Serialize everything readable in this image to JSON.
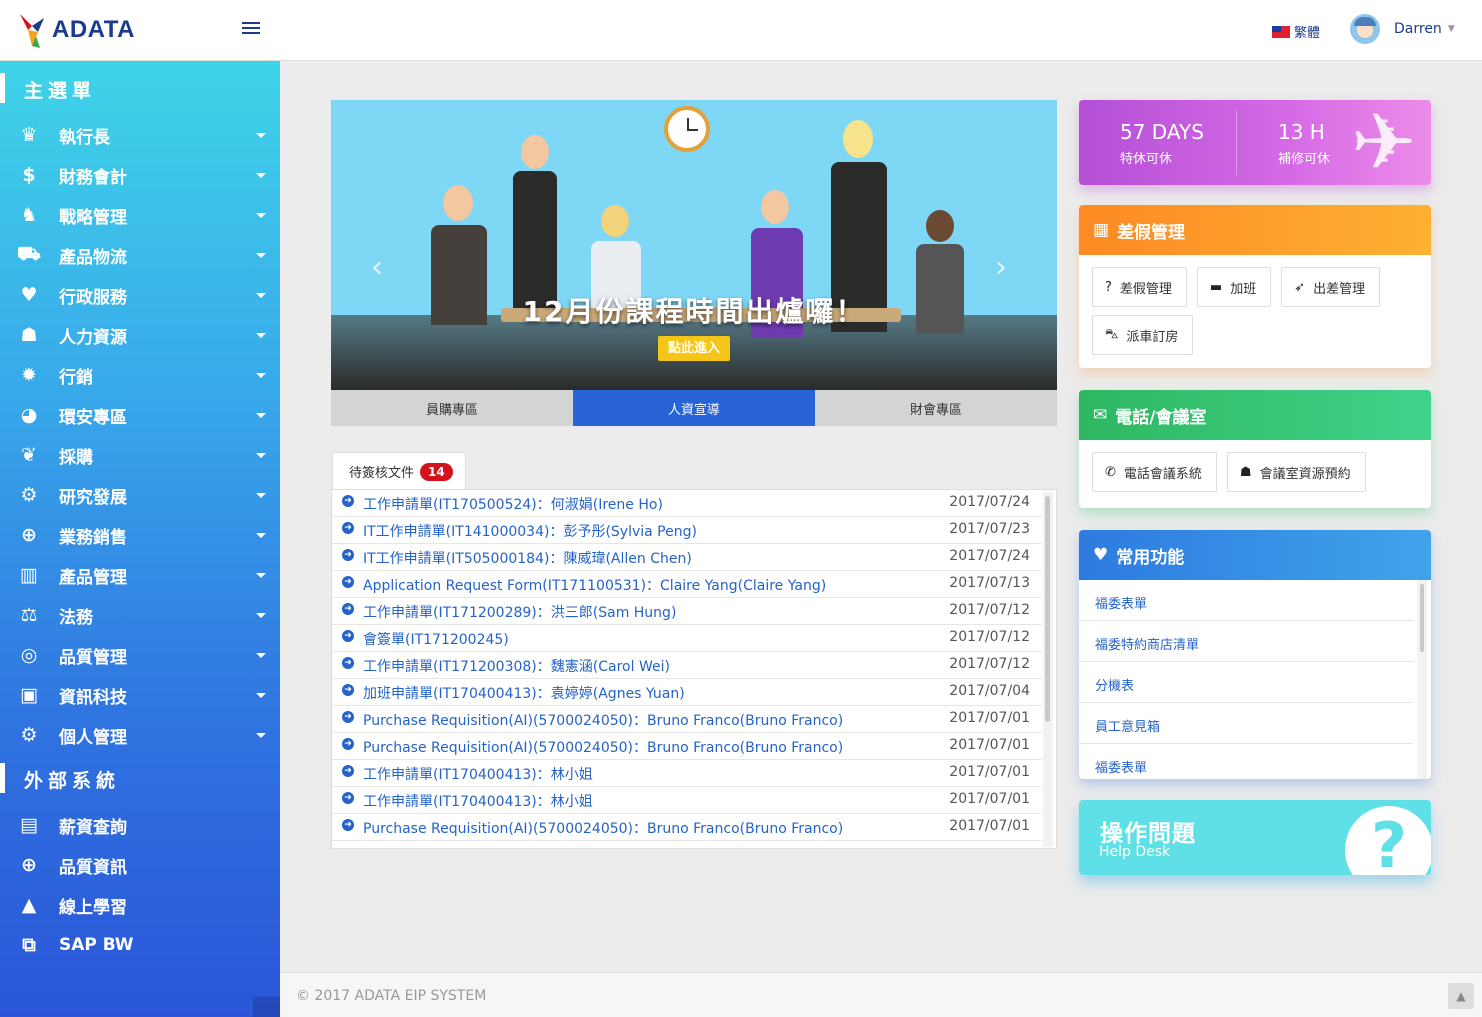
{
  "header": {
    "logo_text": "ADATA",
    "language": "繁體",
    "user_name": "Darren"
  },
  "sidebar": {
    "main_title": "主選單",
    "main_items": [
      {
        "label": "執行長",
        "icon": "crown-icon",
        "glyph": "♛"
      },
      {
        "label": "財務會計",
        "icon": "money-icon",
        "glyph": "$"
      },
      {
        "label": "戰略管理",
        "icon": "chess-knight-icon",
        "glyph": "♞"
      },
      {
        "label": "產品物流",
        "icon": "truck-icon",
        "glyph": "⛟"
      },
      {
        "label": "行政服務",
        "icon": "heart-icon",
        "glyph": "♥"
      },
      {
        "label": "人力資源",
        "icon": "users-icon",
        "glyph": "☗"
      },
      {
        "label": "行銷",
        "icon": "lightbulb-icon",
        "glyph": "✹"
      },
      {
        "label": "環安專區",
        "icon": "globe-icon",
        "glyph": "◕"
      },
      {
        "label": "採購",
        "icon": "plant-icon",
        "glyph": "❦"
      },
      {
        "label": "研究發展",
        "icon": "brain-icon",
        "glyph": "⚙"
      },
      {
        "label": "業務銷售",
        "icon": "network-globe-icon",
        "glyph": "⊕"
      },
      {
        "label": "產品管理",
        "icon": "bar-chart-icon",
        "glyph": "▥"
      },
      {
        "label": "法務",
        "icon": "scale-icon",
        "glyph": "⚖"
      },
      {
        "label": "品質管理",
        "icon": "circle-notch-icon",
        "glyph": "◎"
      },
      {
        "label": "資訊科技",
        "icon": "monitor-icon",
        "glyph": "▣"
      },
      {
        "label": "個人管理",
        "icon": "gear-icon",
        "glyph": "⚙"
      }
    ],
    "external_title": "外部系統",
    "external_items": [
      {
        "label": "薪資查詢",
        "icon": "money-bill-icon",
        "glyph": "▤"
      },
      {
        "label": "品質資訊",
        "icon": "search-plus-icon",
        "glyph": "⊕"
      },
      {
        "label": "線上學習",
        "icon": "graduation-cap-icon",
        "glyph": "▲"
      },
      {
        "label": "SAP BW",
        "icon": "windows-icon",
        "glyph": "⧉"
      }
    ]
  },
  "carousel": {
    "title": "12月份課程時間出爐囉！",
    "button": "點此進入",
    "tabs": [
      {
        "label": "員購專區",
        "active": false
      },
      {
        "label": "人資宣導",
        "active": true
      },
      {
        "label": "財會專區",
        "active": false
      }
    ]
  },
  "pending": {
    "tab_label": "待簽核文件",
    "count": "14",
    "rows": [
      {
        "title": "工作申請單(IT170500524)：何淑娟(Irene Ho)",
        "date": "2017/07/24"
      },
      {
        "title": "IT工作申請單(IT141000034)：彭予彤(Sylvia Peng)",
        "date": "2017/07/23"
      },
      {
        "title": "IT工作申請單(IT505000184)：陳威瑋(Allen Chen)",
        "date": "2017/07/24"
      },
      {
        "title": "Application Request Form(IT171100531)：Claire Yang(Claire Yang)",
        "date": "2017/07/13"
      },
      {
        "title": "工作申請單(IT171200289)：洪三郎(Sam Hung)",
        "date": "2017/07/12"
      },
      {
        "title": "會簽單(IT171200245)",
        "date": "2017/07/12"
      },
      {
        "title": "工作申請單(IT171200308)：魏憲涵(Carol Wei)",
        "date": "2017/07/12"
      },
      {
        "title": "加班申請單(IT170400413)：袁婷婷(Agnes Yuan)",
        "date": "2017/07/04"
      },
      {
        "title": "Purchase Requisition(AI)(5700024050)：Bruno Franco(Bruno Franco)",
        "date": "2017/07/01"
      },
      {
        "title": "Purchase Requisition(AI)(5700024050)：Bruno Franco(Bruno Franco)",
        "date": "2017/07/01"
      },
      {
        "title": "工作申請單(IT170400413)：林小姐",
        "date": "2017/07/01"
      },
      {
        "title": "工作申請單(IT170400413)：林小姐",
        "date": "2017/07/01"
      },
      {
        "title": "Purchase Requisition(AI)(5700024050)：Bruno Franco(Bruno Franco)",
        "date": "2017/07/01"
      }
    ]
  },
  "leave": {
    "special_value": "57 DAYS",
    "special_label": "特休可休",
    "comp_value": "13 H",
    "comp_label": "補修可休"
  },
  "leave_mgmt": {
    "title": "差假管理",
    "buttons": [
      {
        "label": "差假管理",
        "icon": "question-circle-icon",
        "glyph": "?"
      },
      {
        "label": "加班",
        "icon": "briefcase-icon",
        "glyph": "▬"
      },
      {
        "label": "出差管理",
        "icon": "rocket-icon",
        "glyph": "➶"
      },
      {
        "label": "派車訂房",
        "icon": "car-icon",
        "glyph": "⛍"
      }
    ]
  },
  "phone": {
    "title": "電話/會議室",
    "buttons": [
      {
        "label": "電話會議系統",
        "icon": "phone-icon",
        "glyph": "✆"
      },
      {
        "label": "會議室資源預約",
        "icon": "users-icon",
        "glyph": "☗"
      }
    ]
  },
  "favorites": {
    "title": "常用功能",
    "items": [
      "福委表單",
      "福委特約商店清單",
      "分機表",
      "員工意見箱",
      "福委表單"
    ]
  },
  "help": {
    "title": "操作問題",
    "subtitle": "Help Desk"
  },
  "footer": {
    "copyright": "© 2017 ADATA EIP SYSTEM"
  },
  "colors": {
    "sidebar_top": "#3fd4e8",
    "sidebar_bottom": "#2a55d8",
    "accent_blue": "#2863d8",
    "leave_purple": "#b44fd6",
    "leave_orange": "#fda22a",
    "phone_green": "#2fbf71",
    "fav_blue": "#3a8ee6",
    "help_cyan": "#5fe0e6",
    "badge_red": "#d5121c"
  }
}
